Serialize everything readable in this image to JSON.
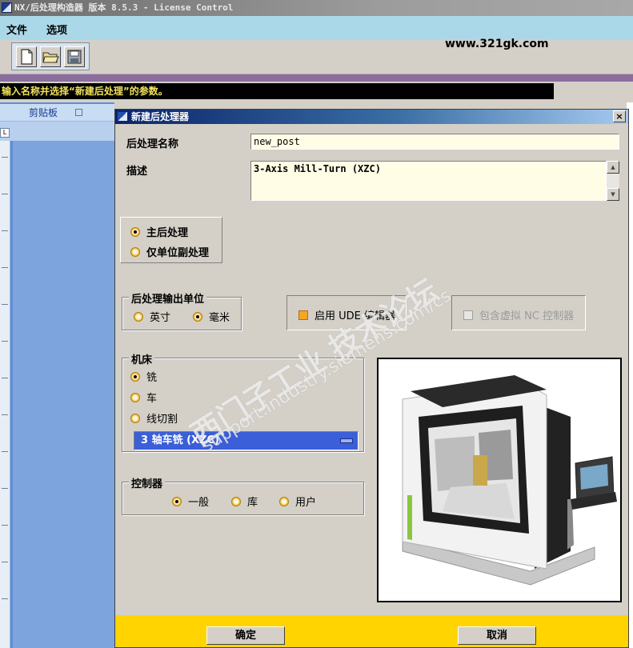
{
  "app": {
    "title": "NX/后处理构造器 版本 8.5.3 - License Control"
  },
  "menu": {
    "items": [
      "文件",
      "选项"
    ]
  },
  "toolbar": {
    "buttons": [
      "new-file-icon",
      "open-folder-icon",
      "save-icon"
    ],
    "watermark_url": "www.321gk.com"
  },
  "status": {
    "text": "输入名称并选择“新建后处理”的参数。"
  },
  "background": {
    "clipboard_tab": "剪贴板",
    "ruler_marker": "L"
  },
  "dialog": {
    "title": "新建后处理器",
    "close_label": "×",
    "post_name_label": "后处理名称",
    "post_name_value": "new_post",
    "description_label": "描述",
    "description_value": "3-Axis Mill-Turn (XZC)",
    "post_type": {
      "options": [
        "主后处理",
        "仅单位副处理"
      ],
      "selected": "主后处理"
    },
    "output_unit": {
      "title": "后处理输出单位",
      "options": [
        "英寸",
        "毫米"
      ],
      "selected": "毫米"
    },
    "ude_editor": {
      "label": "启用 UDE 编辑器",
      "checked": true
    },
    "virtual_nc": {
      "label": "包含虚拟 NC 控制器",
      "checked": false,
      "enabled": false
    },
    "machine": {
      "title": "机床",
      "options": [
        "铣",
        "车",
        "线切割"
      ],
      "selected": "铣",
      "type_value": "3 轴车铣 (XZC)"
    },
    "controller": {
      "title": "控制器",
      "options": [
        "一般",
        "库",
        "用户"
      ],
      "selected": "一般"
    },
    "watermark": {
      "text": "西门子工业 技术论坛",
      "url": "support.industry.siemens.com/cs"
    },
    "buttons": {
      "ok": "确定",
      "cancel": "取消"
    },
    "colors": {
      "footer": "#ffd400",
      "field_bg": "#fffde6",
      "combo_bg": "#3a5fd8",
      "status_text": "#f2e35a"
    }
  }
}
